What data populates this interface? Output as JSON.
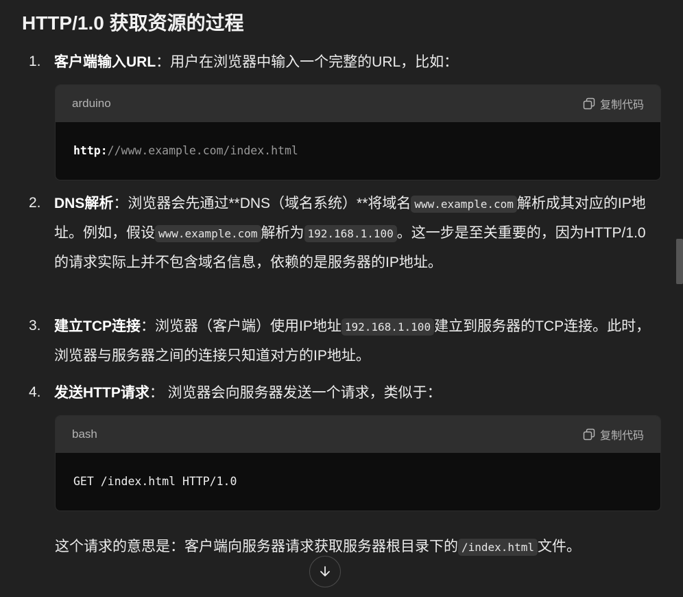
{
  "heading": "HTTP/1.0 获取资源的过程",
  "steps": [
    {
      "num": "1.",
      "title": "客户端输入URL",
      "text_a": "：用户在浏览器中输入一个完整的URL，比如："
    },
    {
      "num": "2.",
      "title": "DNS解析",
      "text_a": "：浏览器会先通过**DNS（域名系统）**将域名",
      "code_a": "www.example.com",
      "text_b": "解析成其对应的IP地址。例如，假设",
      "code_b": "www.example.com",
      "text_c": "解析为",
      "code_c": "192.168.1.100",
      "text_d": "。这一步是至关重要的，因为HTTP/1.0的请求实际上并不包含域名信息，依赖的是服务器的IP地址。"
    },
    {
      "num": "3.",
      "title": "建立TCP连接",
      "text_a": "：浏览器（客户端）使用IP地址",
      "code_a": "192.168.1.100",
      "text_b": "建立到服务器的TCP连接。此时，浏览器与服务器之间的连接只知道对方的IP地址。"
    },
    {
      "num": "4.",
      "title": "发送HTTP请求",
      "text_a": "： 浏览器会向服务器发送一个请求，类似于："
    }
  ],
  "code_blocks": [
    {
      "lang": "arduino",
      "copy_label": "复制代码",
      "proto": "http:",
      "rest": "//www.example.com/index.html"
    },
    {
      "lang": "bash",
      "copy_label": "复制代码",
      "line": "GET /index.html HTTP/1.0"
    }
  ],
  "explanation": {
    "text_a": "这个请求的意思是：客户端向服务器请求获取服务器根目录下的",
    "code": "/index.html",
    "text_b": "文件。"
  },
  "icons": {
    "copy": "copy-icon",
    "scroll_down": "arrow-down-icon"
  }
}
